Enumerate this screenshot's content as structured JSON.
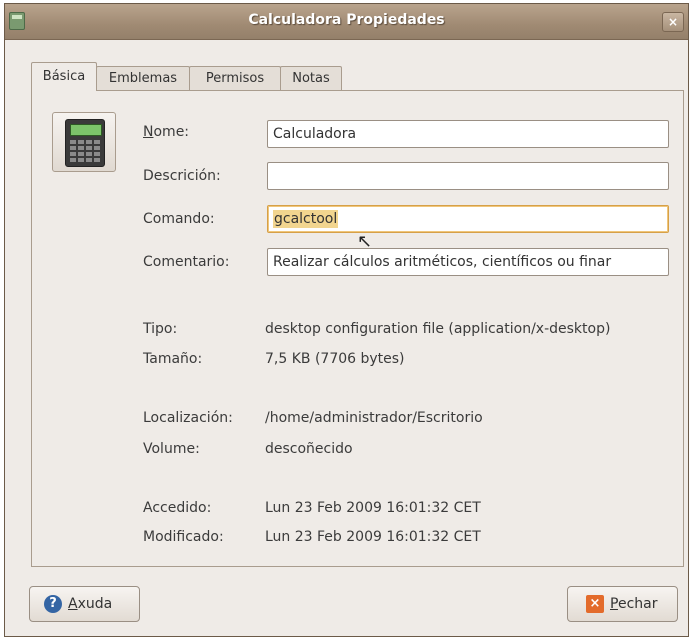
{
  "window": {
    "title": "Calculadora Propiedades",
    "close_glyph": "×"
  },
  "tabs": [
    {
      "label": "Básica",
      "active": true
    },
    {
      "label": "Emblemas",
      "active": false
    },
    {
      "label": "Permisos",
      "active": false
    },
    {
      "label": "Notas",
      "active": false
    }
  ],
  "form": {
    "name_label_rest": "ome:",
    "name_label_first": "N",
    "name_value": "Calculadora",
    "description_label": "Descrición:",
    "description_value": "",
    "command_label": "Comando:",
    "command_value": "gcalctool",
    "comment_label": "Comentario:",
    "comment_value": "Realizar cálculos aritméticos, científicos ou finar"
  },
  "info": {
    "type_label": "Tipo:",
    "type_value": "desktop configuration file (application/x-desktop)",
    "size_label": "Tamaño:",
    "size_value": "7,5 KB (7706 bytes)",
    "location_label": "Localización:",
    "location_value": "/home/administrador/Escritorio",
    "volume_label": "Volume:",
    "volume_value": "descoñecido",
    "accessed_label": "Accedido:",
    "accessed_value": "Lun 23 Feb 2009 16:01:32 CET",
    "modified_label": "Modificado:",
    "modified_value": "Lun 23 Feb 2009 16:01:32 CET"
  },
  "buttons": {
    "help_first": "A",
    "help_rest": "xuda",
    "close_first": "P",
    "close_rest": "echar"
  },
  "icons": [
    "app-icon",
    "calculator-icon",
    "help-icon",
    "close-icon",
    "mouse-cursor-icon"
  ]
}
